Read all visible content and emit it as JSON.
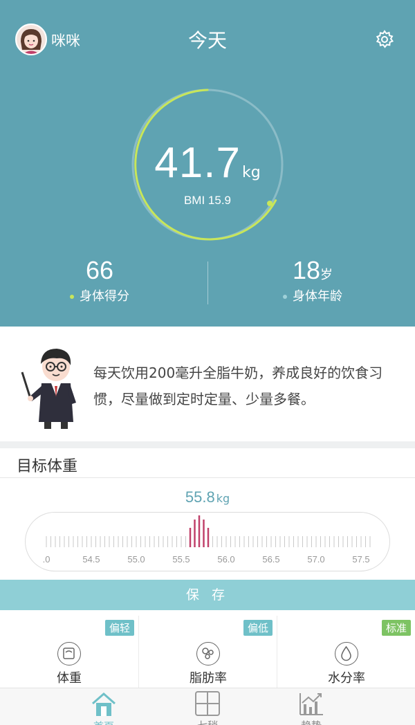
{
  "header": {
    "title": "今天",
    "user_name": "咪咪",
    "weight_value": "41.7",
    "weight_unit": "kg",
    "bmi_label": "BMI 15.9",
    "body_score_value": "66",
    "body_score_label": "身体得分",
    "body_age_value": "18",
    "body_age_unit": "岁",
    "body_age_label": "身体年龄"
  },
  "tip": {
    "text": "每天饮用200毫升全脂牛奶，养成良好的饮食习惯，尽量做到定时定量、少量多餐。"
  },
  "target": {
    "title": "目标体重",
    "value": "55.8",
    "unit": "kg",
    "ruler_labels": [
      ".0",
      "54.5",
      "55.0",
      "55.5",
      "56.0",
      "56.5",
      "57.0",
      "57.5"
    ],
    "save_label": "保 存"
  },
  "metrics": [
    {
      "label": "体重",
      "badge": "偏轻",
      "icon": "scale-icon"
    },
    {
      "label": "脂肪率",
      "badge": "偏低",
      "icon": "fat-icon"
    },
    {
      "label": "水分率",
      "badge": "标准",
      "icon": "water-drop-icon"
    }
  ],
  "nav": [
    {
      "label": "首页",
      "icon": "home-icon"
    },
    {
      "label": "七稍",
      "icon": "grid-icon"
    },
    {
      "label": "趋势",
      "icon": "trend-chart-icon"
    }
  ],
  "colors": {
    "primary": "#5fa3b2",
    "ring_progress": "#c8e65a",
    "accent": "#c0406a",
    "badge_teal": "#6fc0c8",
    "badge_green": "#7dc363",
    "save_button": "#8fcfd6"
  }
}
